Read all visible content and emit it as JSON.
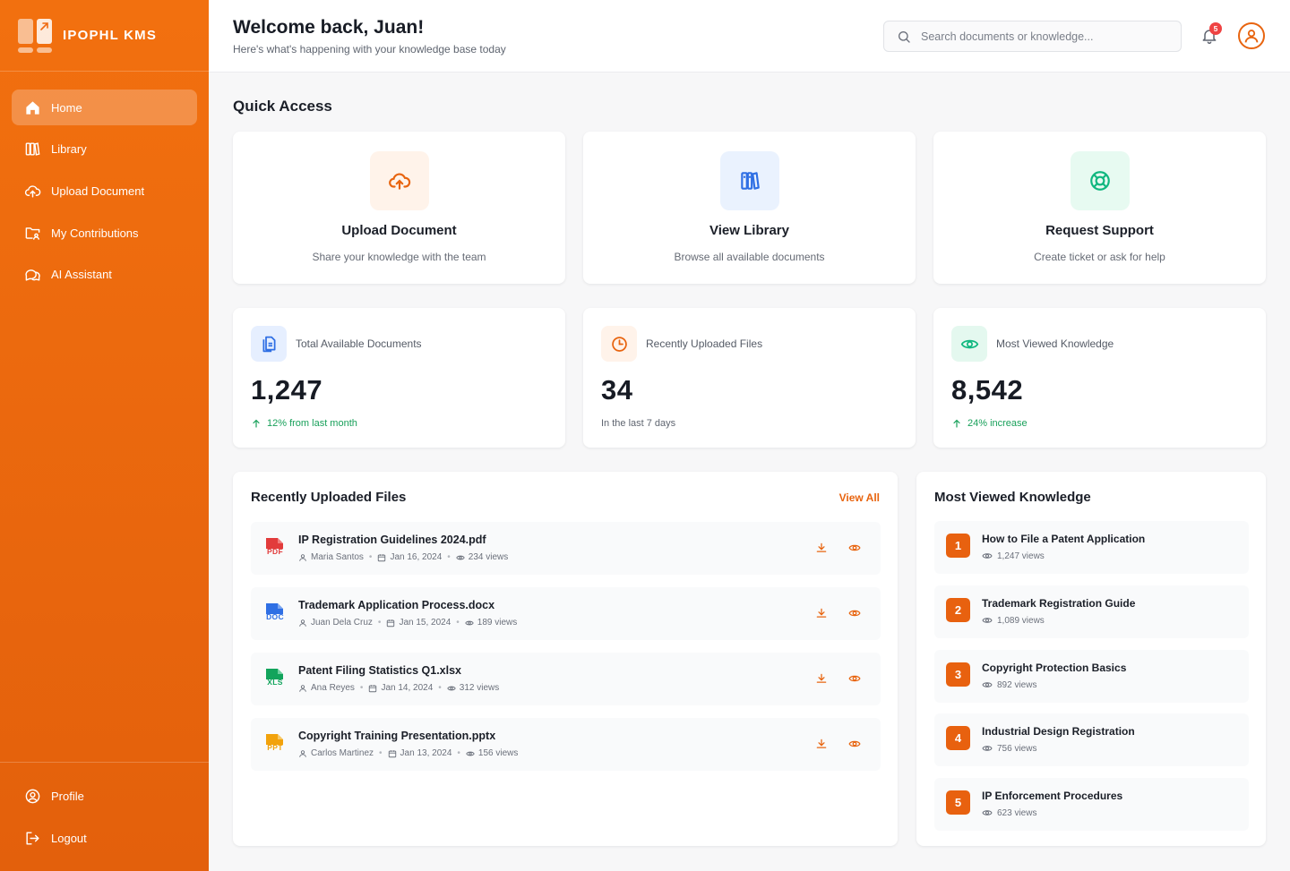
{
  "brand": {
    "name": "IPOPHL KMS"
  },
  "colors": {
    "accent": "#e8640f",
    "success": "#18a05a",
    "danger": "#ef4343",
    "blue": "#2f6fe4",
    "green": "#10b77f"
  },
  "sidebar": {
    "items": [
      {
        "label": "Home",
        "icon": "home-icon",
        "active": true
      },
      {
        "label": "Library",
        "icon": "library-icon"
      },
      {
        "label": "Upload Document",
        "icon": "cloud-upload-icon"
      },
      {
        "label": "My Contributions",
        "icon": "folder-user-icon"
      },
      {
        "label": "AI Assistant",
        "icon": "chat-icon"
      }
    ],
    "bottom": [
      {
        "label": "Profile",
        "icon": "user-circle-icon"
      },
      {
        "label": "Logout",
        "icon": "logout-icon"
      }
    ]
  },
  "header": {
    "title": "Welcome back, Juan!",
    "subtitle": "Here's what's happening with your knowledge base today",
    "search_placeholder": "Search documents or knowledge...",
    "notifications": "5"
  },
  "quick_access": {
    "title": "Quick Access",
    "cards": [
      {
        "title": "Upload Document",
        "desc": "Share your knowledge with the team",
        "icon": "cloud-upload-icon"
      },
      {
        "title": "View Library",
        "desc": "Browse all available documents",
        "icon": "books-icon"
      },
      {
        "title": "Request Support",
        "desc": "Create ticket or ask for help",
        "icon": "lifebuoy-icon"
      }
    ]
  },
  "stats": [
    {
      "label": "Total Available Documents",
      "value": "1,247",
      "foot": "12% from last month",
      "trend": "up",
      "icon": "document-icon"
    },
    {
      "label": "Recently Uploaded Files",
      "value": "34",
      "foot": "In the last 7 days",
      "trend": "neutral",
      "icon": "clock-icon"
    },
    {
      "label": "Most Viewed Knowledge",
      "value": "8,542",
      "foot": "24% increase",
      "trend": "up",
      "icon": "eye-icon"
    }
  ],
  "recent": {
    "title": "Recently Uploaded Files",
    "view_all": "View All",
    "files": [
      {
        "name": "IP Registration Guidelines 2024.pdf",
        "type": "PDF",
        "author": "Maria Santos",
        "date": "Jan 16, 2024",
        "views": "234 views",
        "color": "#e23b3b"
      },
      {
        "name": "Trademark Application Process.docx",
        "type": "DOC",
        "author": "Juan Dela Cruz",
        "date": "Jan 15, 2024",
        "views": "189 views",
        "color": "#2f6fe4"
      },
      {
        "name": "Patent Filing Statistics Q1.xlsx",
        "type": "XLS",
        "author": "Ana Reyes",
        "date": "Jan 14, 2024",
        "views": "312 views",
        "color": "#12a45c"
      },
      {
        "name": "Copyright Training Presentation.pptx",
        "type": "PPT",
        "author": "Carlos Martinez",
        "date": "Jan 13, 2024",
        "views": "156 views",
        "color": "#f2a20c"
      }
    ]
  },
  "most_viewed": {
    "title": "Most Viewed Knowledge",
    "items": [
      {
        "rank": "1",
        "title": "How to File a Patent Application",
        "views": "1,247 views"
      },
      {
        "rank": "2",
        "title": "Trademark Registration Guide",
        "views": "1,089 views"
      },
      {
        "rank": "3",
        "title": "Copyright Protection Basics",
        "views": "892 views"
      },
      {
        "rank": "4",
        "title": "Industrial Design Registration",
        "views": "756 views"
      },
      {
        "rank": "5",
        "title": "IP Enforcement Procedures",
        "views": "623 views"
      }
    ]
  }
}
